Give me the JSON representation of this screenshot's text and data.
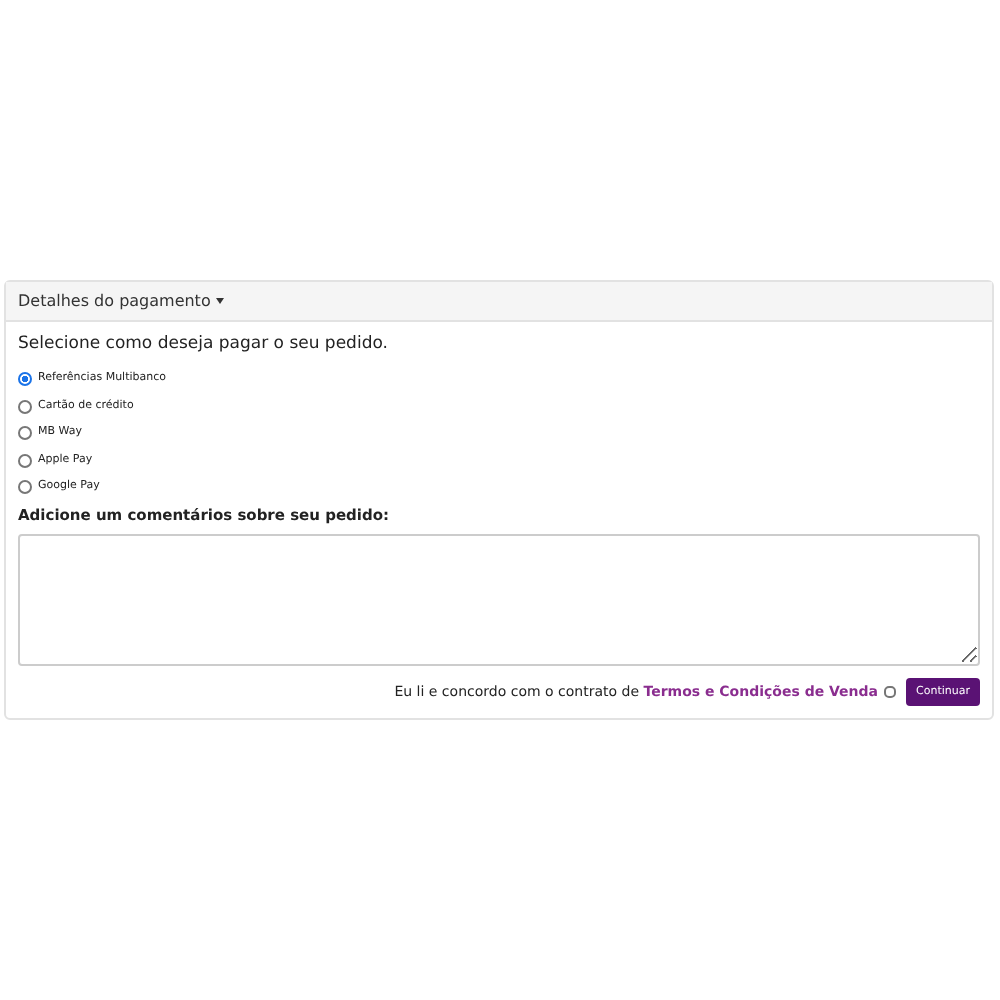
{
  "panel": {
    "title": "Detalhes do pagamento",
    "expanded": true
  },
  "prompt": "Selecione como deseja pagar o seu pedido.",
  "payment_options": [
    {
      "label": "Referências Multibanco",
      "selected": true
    },
    {
      "label": "Cartão de crédito",
      "selected": false
    },
    {
      "label": "MB Way",
      "selected": false
    },
    {
      "label": "Apple Pay",
      "selected": false
    },
    {
      "label": "Google Pay",
      "selected": false
    }
  ],
  "comments": {
    "label": "Adicione um comentários sobre seu pedido:"
  },
  "terms": {
    "text": "Eu li e concordo com o contrato de",
    "link": "Termos e Condições de Venda",
    "checked": false
  },
  "buttons": [
    "Continuar"
  ]
}
